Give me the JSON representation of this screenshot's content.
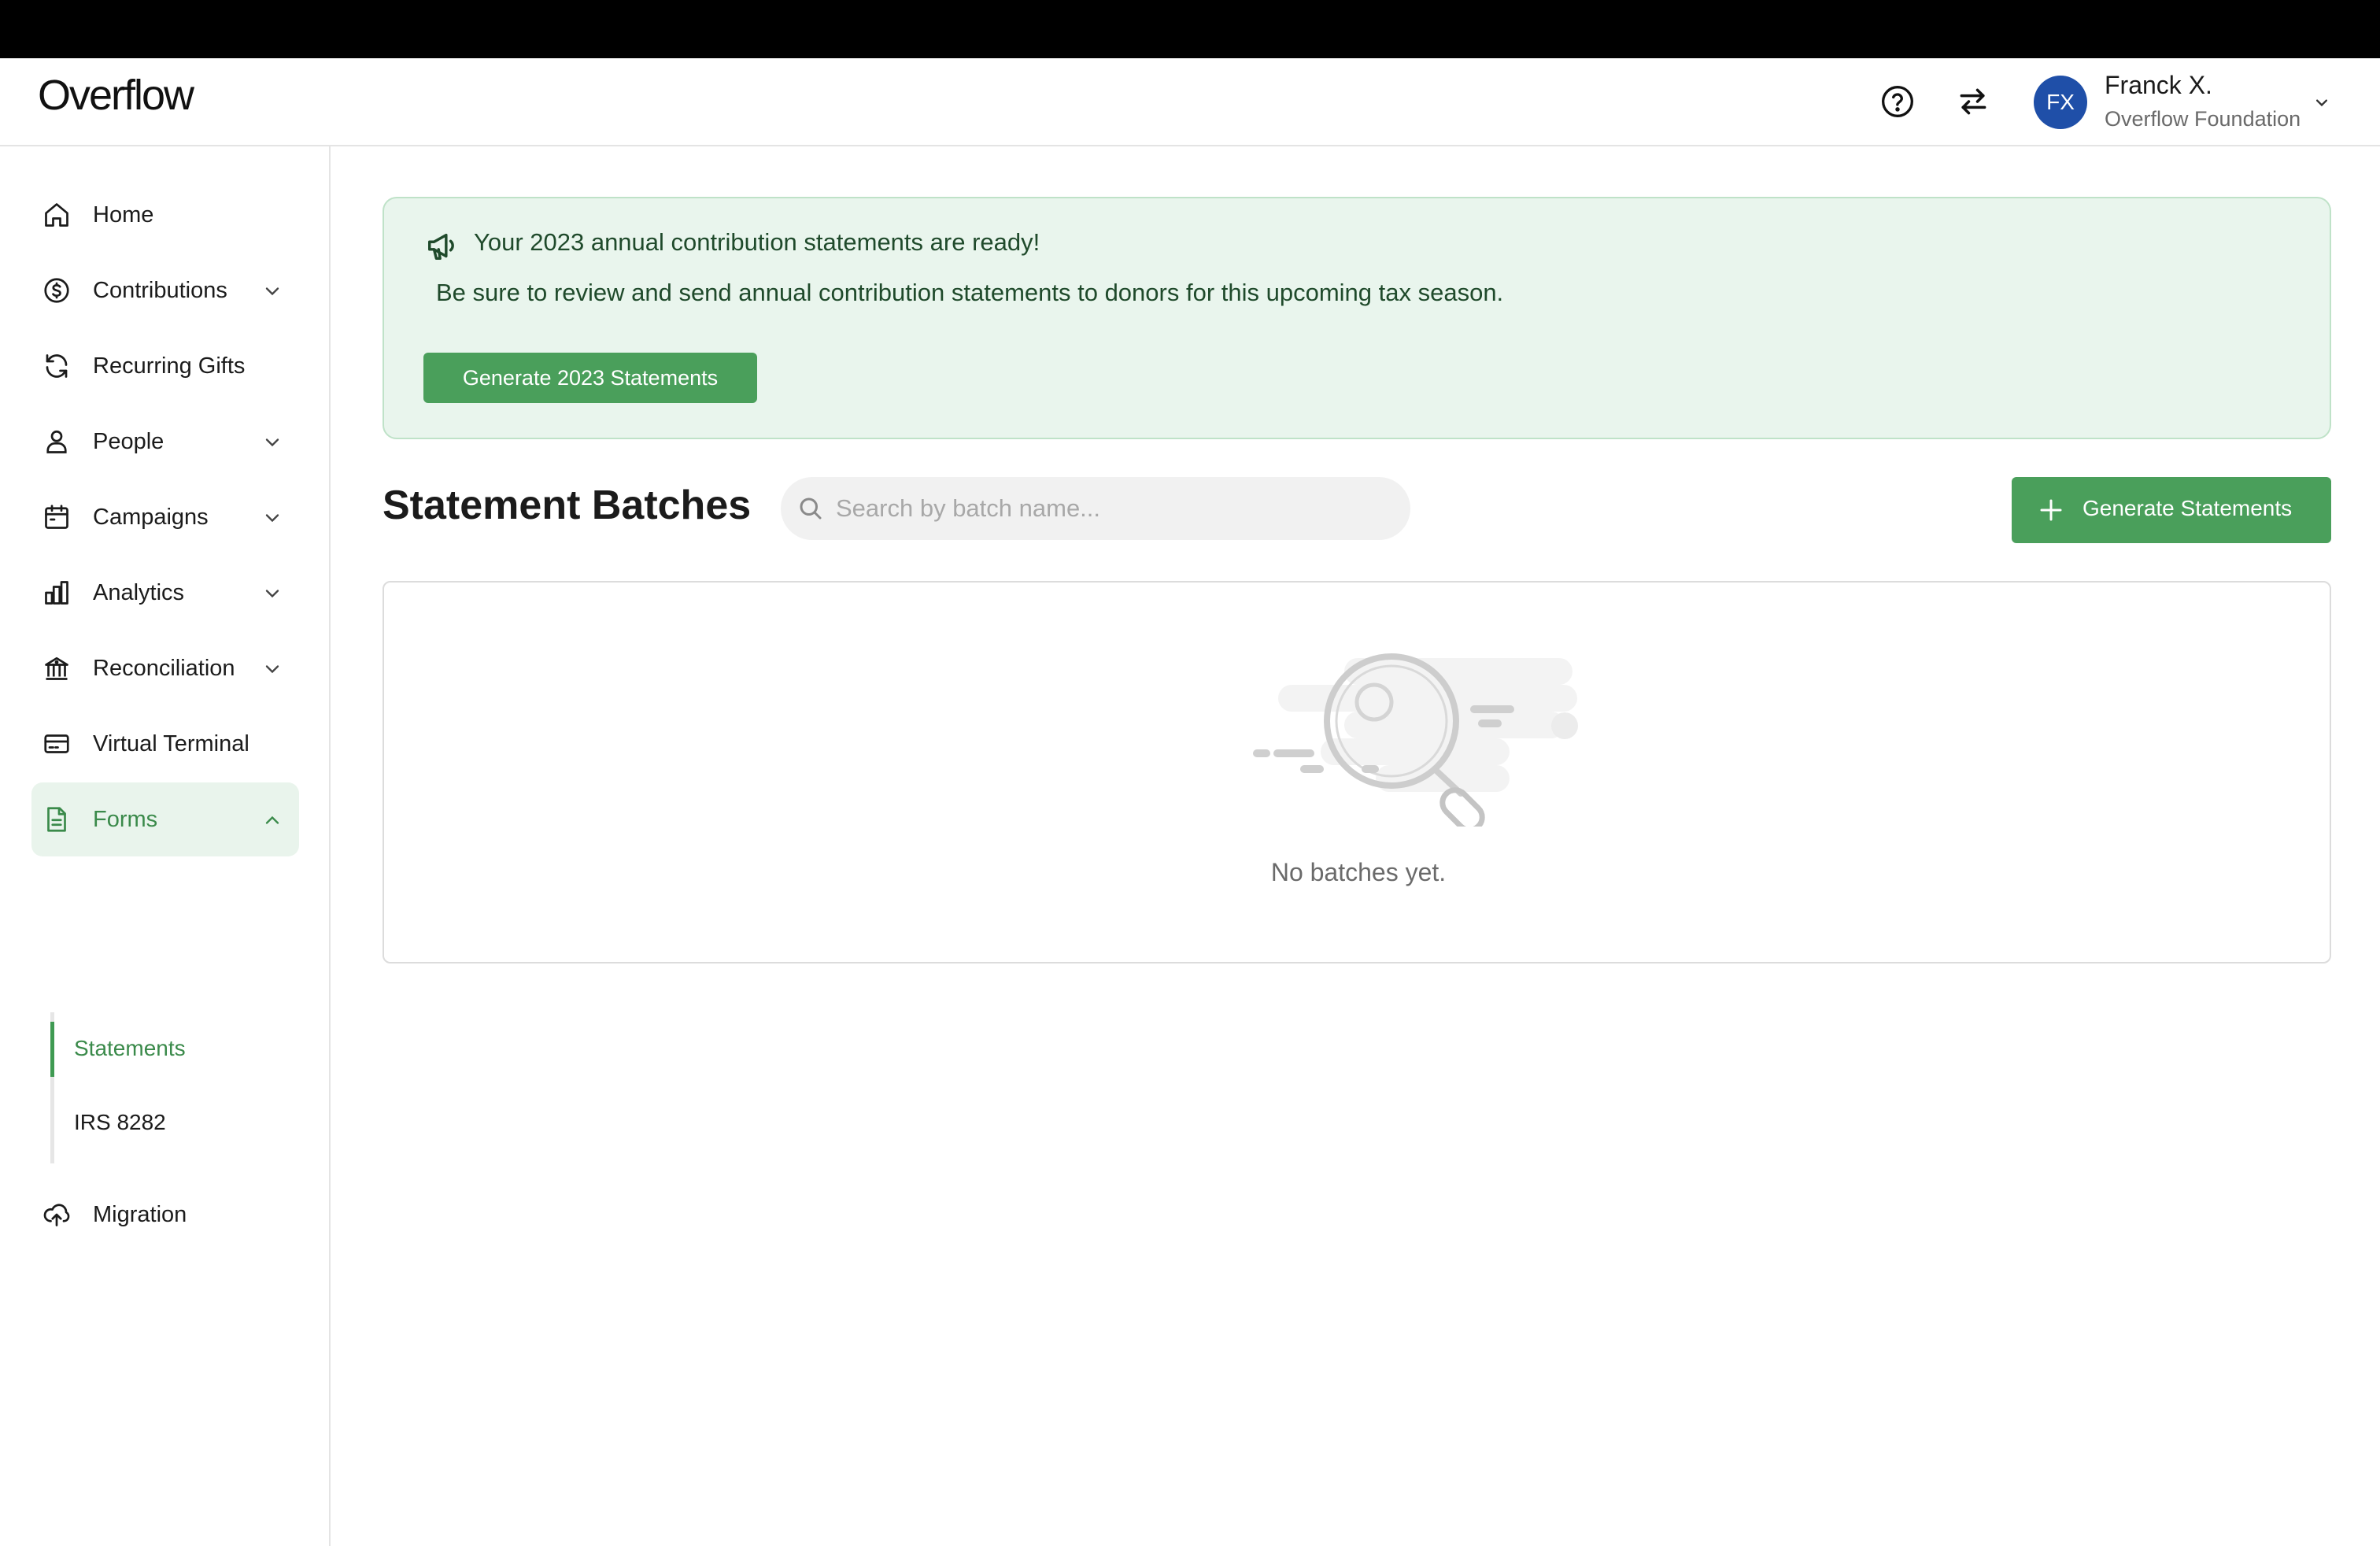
{
  "app": {
    "logo": "Overflow"
  },
  "header": {
    "help_icon": "help-circle-icon",
    "switch_icon": "switch-arrows-icon",
    "user": {
      "initials": "FX",
      "name": "Franck X.",
      "org": "Overflow Foundation"
    }
  },
  "sidebar": {
    "items": [
      {
        "label": "Home",
        "icon": "home-icon"
      },
      {
        "label": "Contributions",
        "icon": "dollar-circle-icon",
        "expandable": true
      },
      {
        "label": "Recurring Gifts",
        "icon": "refresh-icon"
      },
      {
        "label": "People",
        "icon": "person-icon",
        "expandable": true
      },
      {
        "label": "Campaigns",
        "icon": "calendar-icon",
        "expandable": true
      },
      {
        "label": "Analytics",
        "icon": "bar-chart-icon",
        "expandable": true
      },
      {
        "label": "Reconciliation",
        "icon": "bank-icon",
        "expandable": true
      },
      {
        "label": "Virtual Terminal",
        "icon": "credit-card-icon"
      },
      {
        "label": "Forms",
        "icon": "document-icon",
        "expandable": true,
        "expanded": true,
        "active": true
      },
      {
        "label": "Migration",
        "icon": "upload-cloud-icon"
      }
    ],
    "forms_sub": [
      {
        "label": "Statements",
        "active": true
      },
      {
        "label": "IRS 8282"
      }
    ]
  },
  "banner": {
    "title": "Your 2023 annual contribution statements are ready!",
    "text": "Be sure to review and send annual contribution statements to donors for this upcoming tax season.",
    "button": "Generate 2023 Statements"
  },
  "statements": {
    "title": "Statement Batches",
    "search_placeholder": "Search by batch name...",
    "generate_button": "Generate Statements",
    "empty_text": "No batches yet."
  },
  "colors": {
    "accent": "#4a9f5b",
    "accent_dark_text": "#1f4a2b",
    "banner_bg": "#e9f5ed",
    "avatar": "#1f4fa8"
  }
}
